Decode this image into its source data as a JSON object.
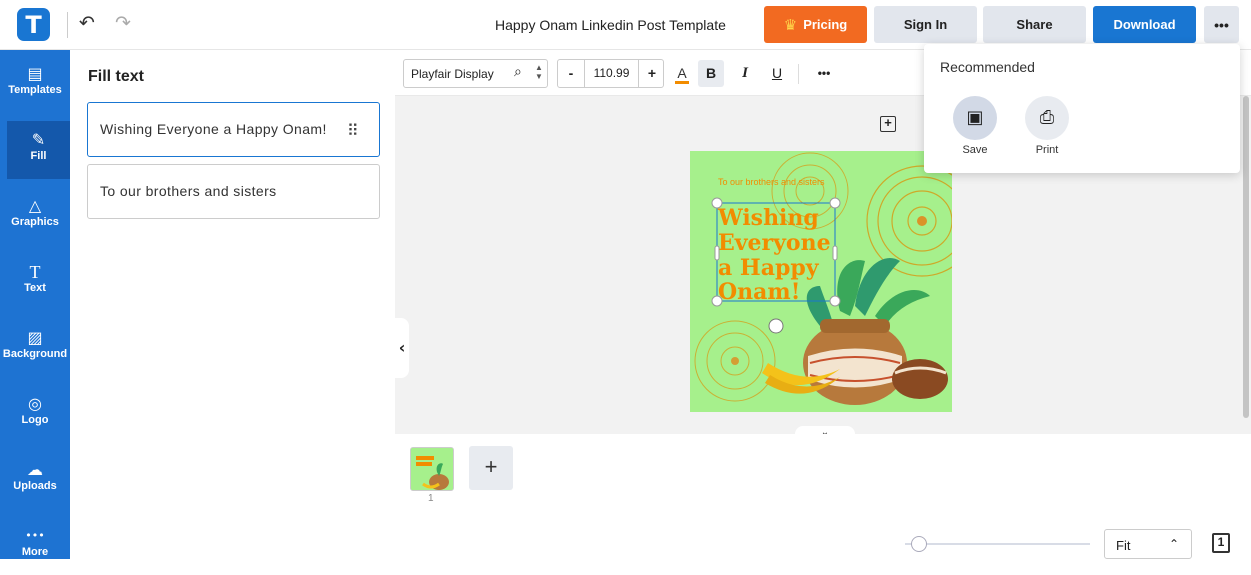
{
  "header": {
    "logo_letter": "T",
    "undo_icon": "undo-icon",
    "redo_icon": "redo-icon",
    "title": "Happy Onam Linkedin Post Template",
    "pricing_label": "Pricing",
    "signin_label": "Sign In",
    "share_label": "Share",
    "download_label": "Download",
    "more_label": "•••"
  },
  "sidebar": {
    "items": [
      {
        "label": "Templates",
        "icon": "templates-icon",
        "glyph": "▤"
      },
      {
        "label": "Fill",
        "icon": "pencil-icon",
        "glyph": "✎"
      },
      {
        "label": "Graphics",
        "icon": "shapes-icon",
        "glyph": "△"
      },
      {
        "label": "Text",
        "icon": "text-icon",
        "glyph": "T"
      },
      {
        "label": "Background",
        "icon": "background-icon",
        "glyph": "▨"
      },
      {
        "label": "Logo",
        "icon": "logo-icon",
        "glyph": "◎"
      },
      {
        "label": "Uploads",
        "icon": "cloud-upload-icon",
        "glyph": "☁"
      },
      {
        "label": "More",
        "icon": "more-icon",
        "glyph": "•••"
      }
    ],
    "active": "Fill"
  },
  "panel": {
    "title": "Fill text",
    "fields": [
      "Wishing Everyone a Happy Onam!",
      "To our brothers and sisters"
    ]
  },
  "toolbar": {
    "font": "Playfair Display",
    "font_size": "110.99",
    "minus_label": "-",
    "plus_label": "+",
    "color_label": "A",
    "bold_label": "B",
    "italic_label": "I",
    "underline_label": "U",
    "more_label": "•••",
    "text_color": "#f28c00"
  },
  "design": {
    "subtitle": "To our brothers and sisters",
    "headline": [
      "Wishing",
      "Everyone",
      "a Happy",
      "Onam!"
    ],
    "background_color": "#a6f08c",
    "headline_color": "#f28c00"
  },
  "pages": {
    "thumb_number": "1",
    "add_label": "+"
  },
  "zoom": {
    "value": "Fit",
    "level": 0.05
  },
  "dropdown": {
    "title": "Recommended",
    "items": [
      {
        "label": "Save",
        "icon": "save-icon"
      },
      {
        "label": "Print",
        "icon": "print-icon"
      }
    ]
  },
  "colors": {
    "brand": "#1976d2",
    "pricing": "#f26a21",
    "sidebar": "#1e73d2"
  }
}
